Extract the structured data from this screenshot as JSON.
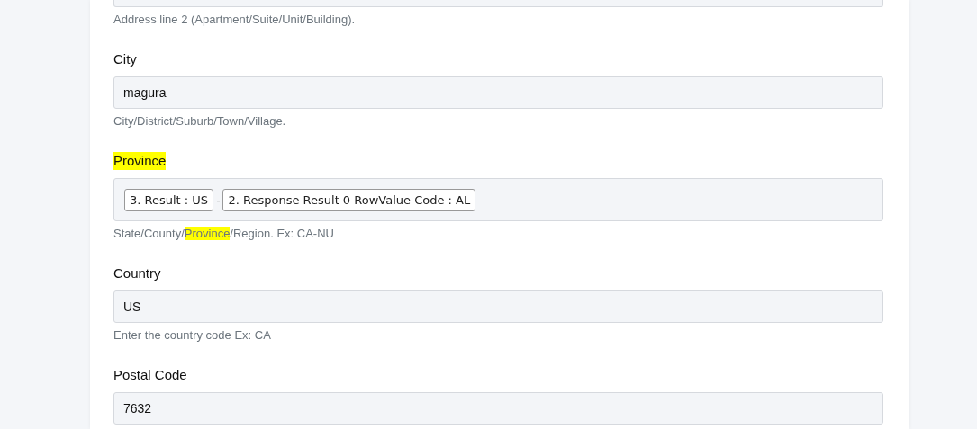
{
  "fields": [
    {
      "kind": "text",
      "help": [
        {
          "text": "Address line 2 (Apartment/Suite/Unit/Building).",
          "highlighted": false
        }
      ]
    },
    {
      "kind": "text",
      "label": "City",
      "label_highlighted": false,
      "value": "magura",
      "help": [
        {
          "text": "City/District/Suburb/Town/Village.",
          "highlighted": false
        }
      ]
    },
    {
      "kind": "tokens",
      "label": "Province",
      "label_highlighted": true,
      "tokens": [
        {
          "kind": "token",
          "text": "3. Result : US"
        },
        {
          "kind": "separator",
          "text": "-"
        },
        {
          "kind": "token",
          "text": "2. Response Result 0 RowValue Code : AL"
        }
      ],
      "help": [
        {
          "text": "State/County/",
          "highlighted": false
        },
        {
          "text": "Province",
          "highlighted": true
        },
        {
          "text": "/Region. Ex: CA-NU",
          "highlighted": false
        }
      ]
    },
    {
      "kind": "text",
      "label": "Country",
      "label_highlighted": false,
      "value": "US",
      "help": [
        {
          "text": "Enter the country code Ex: CA",
          "highlighted": false
        }
      ]
    },
    {
      "kind": "text",
      "label": "Postal Code",
      "label_highlighted": false,
      "value": "7632"
    }
  ]
}
